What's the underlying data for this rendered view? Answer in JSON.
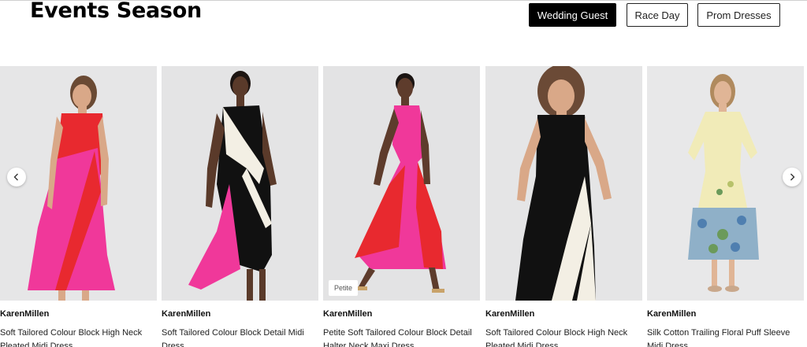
{
  "header": {
    "title": "Events Season",
    "filters": [
      "Wedding Guest",
      "Race Day",
      "Prom Dresses"
    ],
    "active_filter": "Wedding Guest"
  },
  "carousel": {
    "prev_icon": "chevron-left-icon",
    "next_icon": "chevron-right-icon",
    "products": [
      {
        "brand": "KarenMillen",
        "name": "Soft Tailored Colour Block High Neck Pleated Midi Dress",
        "tag": ""
      },
      {
        "brand": "KarenMillen",
        "name": "Soft Tailored Colour Block Detail Midi Dress",
        "tag": ""
      },
      {
        "brand": "KarenMillen",
        "name": "Petite Soft Tailored Colour Block Detail Halter Neck Maxi Dress",
        "tag": "Petite"
      },
      {
        "brand": "KarenMillen",
        "name": "Soft Tailored Colour Block High Neck Pleated Midi Dress",
        "tag": ""
      },
      {
        "brand": "KarenMillen",
        "name": "Silk Cotton Trailing Floral Puff Sleeve Midi Dress",
        "tag": ""
      }
    ]
  },
  "colors": {
    "active_filter_bg": "#000000",
    "pink": "#f0389a",
    "red": "#e8292f",
    "black": "#111111",
    "ivory": "#f3efe4"
  }
}
